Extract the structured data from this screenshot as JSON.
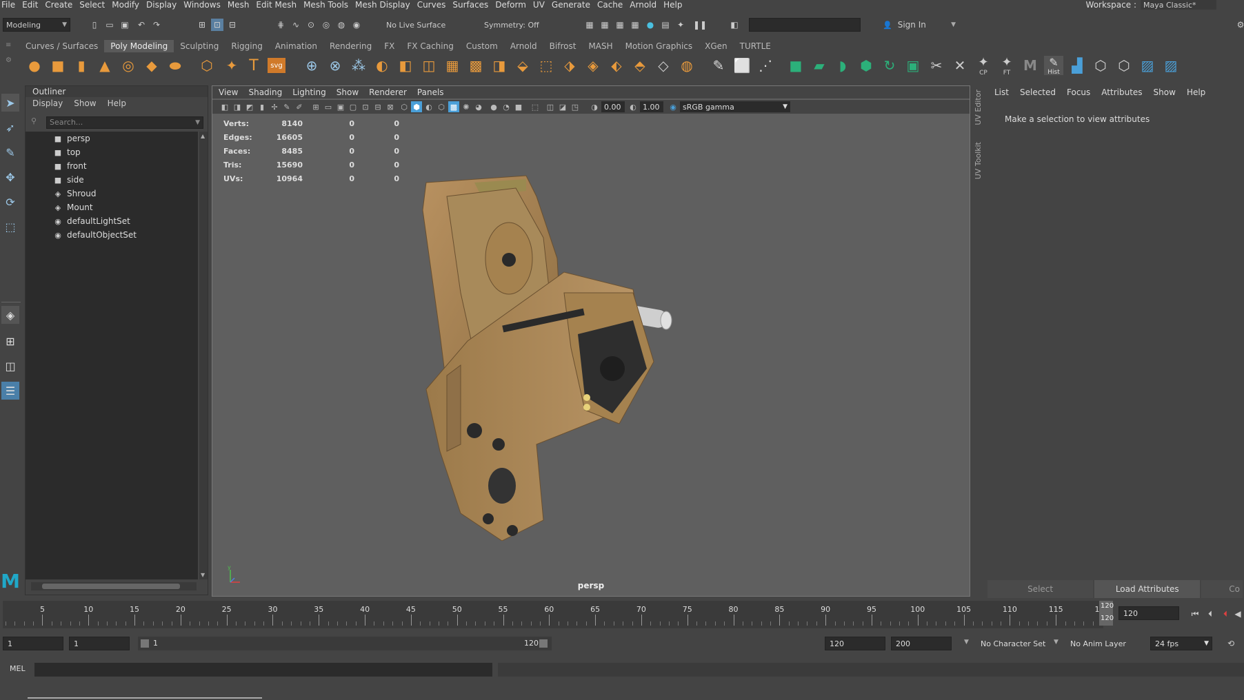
{
  "menubar": {
    "items": [
      "File",
      "Edit",
      "Create",
      "Select",
      "Modify",
      "Display",
      "Windows",
      "Mesh",
      "Edit Mesh",
      "Mesh Tools",
      "Mesh Display",
      "Curves",
      "Surfaces",
      "Deform",
      "UV",
      "Generate",
      "Cache",
      "Arnold",
      "Help"
    ],
    "workspace_label": "Workspace :",
    "workspace_value": "Maya Classic*"
  },
  "statusline": {
    "mode": "Modeling",
    "live_surface": "No Live Surface",
    "symmetry": "Symmetry: Off",
    "sign_in": "Sign In"
  },
  "shelf": {
    "tabs": [
      "Curves / Surfaces",
      "Poly Modeling",
      "Sculpting",
      "Rigging",
      "Animation",
      "Rendering",
      "FX",
      "FX Caching",
      "Custom",
      "Arnold",
      "Bifrost",
      "MASH",
      "Motion Graphics",
      "XGen",
      "TURTLE"
    ],
    "active_tab": "Poly Modeling",
    "icon_labels": {
      "text": "T",
      "svg": "svg",
      "cp": "CP",
      "ft": "FT",
      "hist": "Hist",
      "maya": "M"
    }
  },
  "outliner": {
    "title": "Outliner",
    "menu": [
      "Display",
      "Show",
      "Help"
    ],
    "search_placeholder": "Search...",
    "items": [
      {
        "label": "persp",
        "icon": "camera-icon"
      },
      {
        "label": "top",
        "icon": "camera-icon"
      },
      {
        "label": "front",
        "icon": "camera-icon"
      },
      {
        "label": "side",
        "icon": "camera-icon"
      },
      {
        "label": "Shroud",
        "icon": "mesh-icon"
      },
      {
        "label": "Mount",
        "icon": "mesh-icon"
      },
      {
        "label": "defaultLightSet",
        "icon": "set-icon"
      },
      {
        "label": "defaultObjectSet",
        "icon": "set-icon"
      }
    ]
  },
  "viewport": {
    "menu": [
      "View",
      "Shading",
      "Lighting",
      "Show",
      "Renderer",
      "Panels"
    ],
    "exposure": "0.00",
    "gamma": "1.00",
    "color_space": "sRGB gamma",
    "camera_label": "persp",
    "hud": [
      {
        "label": "Verts:",
        "total": "8140",
        "sel": "0",
        "comp": "0"
      },
      {
        "label": "Edges:",
        "total": "16605",
        "sel": "0",
        "comp": "0"
      },
      {
        "label": "Faces:",
        "total": "8485",
        "sel": "0",
        "comp": "0"
      },
      {
        "label": "Tris:",
        "total": "15690",
        "sel": "0",
        "comp": "0"
      },
      {
        "label": "UVs:",
        "total": "10964",
        "sel": "0",
        "comp": "0"
      }
    ],
    "axis_label": "y"
  },
  "sidetabs": [
    "UV Editor",
    "UV Toolkit"
  ],
  "attribute_editor": {
    "menu": [
      "List",
      "Selected",
      "Focus",
      "Attributes",
      "Show",
      "Help"
    ],
    "message": "Make a selection to view attributes",
    "select_button": "Select",
    "load_button": "Load Attributes",
    "copy_button": "Co"
  },
  "timeslider": {
    "ticks": [
      "5",
      "10",
      "15",
      "20",
      "25",
      "30",
      "35",
      "40",
      "45",
      "50",
      "55",
      "60",
      "65",
      "70",
      "75",
      "80",
      "85",
      "90",
      "95",
      "100",
      "105",
      "110",
      "115",
      "120"
    ],
    "current_frame": "120",
    "current_field": "120"
  },
  "range": {
    "start": "1",
    "playback_start": "1",
    "slider_start": "1",
    "slider_end": "120",
    "playback_end": "120",
    "end": "200",
    "character_set": "No Character Set",
    "anim_layer": "No Anim Layer",
    "fps": "24 fps"
  },
  "cmdline": {
    "label": "MEL"
  },
  "colors": {
    "ui_bg": "#444444",
    "viewport_bg": "#5f5f5f",
    "field_bg": "#2b2b2b",
    "model_tan": "#a5824f",
    "accent_blue": "#4a9fd8"
  }
}
